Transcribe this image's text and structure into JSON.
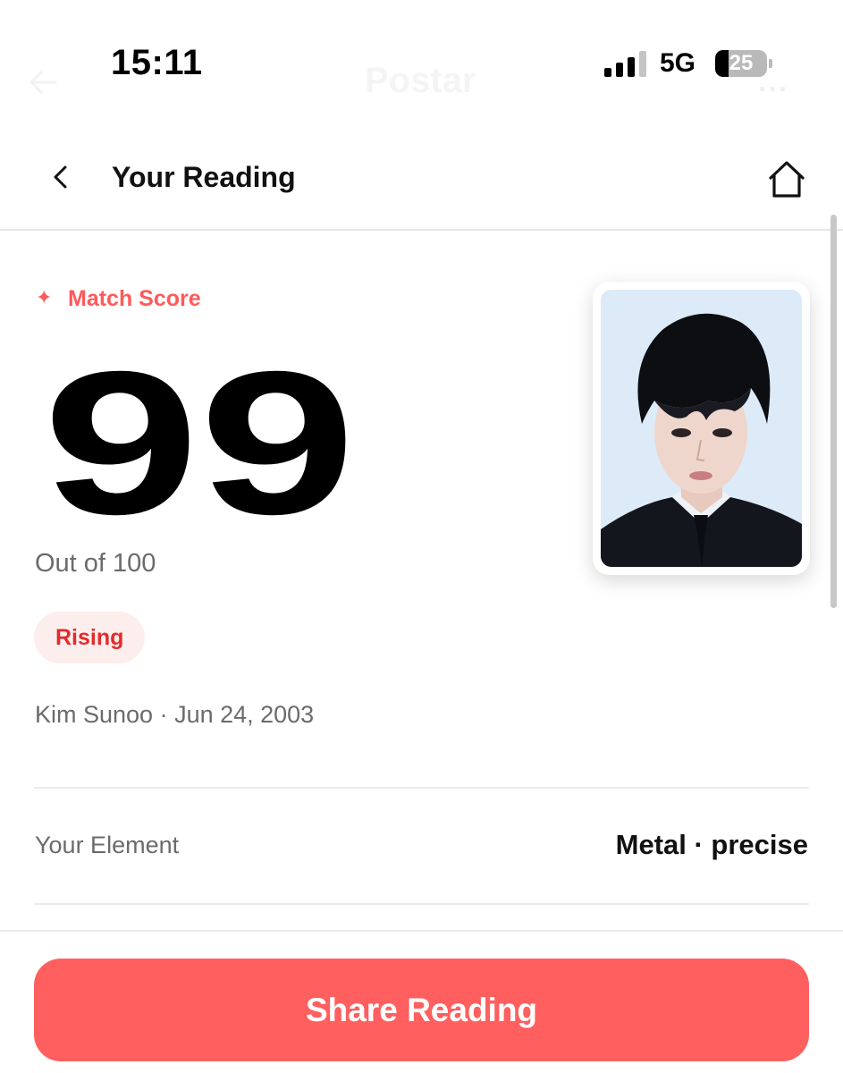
{
  "status_bar": {
    "time": "15:11",
    "network": "5G",
    "battery_percent": "25",
    "battery_level": 0.25,
    "signal_bars_filled": 3,
    "signal_bars_total": 4
  },
  "background": {
    "title_ghost": "Postar",
    "more_ghost": "..."
  },
  "nav": {
    "title": "Your Reading",
    "back_icon": "chevron-left-icon",
    "home_icon": "home-icon"
  },
  "match": {
    "label": "Match Score",
    "score": "99",
    "out_of": "Out of 100",
    "status": "Rising"
  },
  "person": {
    "line": "Kim Sunoo · Jun 24, 2003"
  },
  "element_row": {
    "label": "Your Element",
    "value": "Metal · precise"
  },
  "actions": {
    "share_label": "Share Reading"
  },
  "colors": {
    "accent": "#ff5f5f",
    "accent_text": "#ff5a5a",
    "pill_bg": "#fdeeee",
    "pill_text": "#e32b2b",
    "muted_text": "#6b6b6b"
  }
}
